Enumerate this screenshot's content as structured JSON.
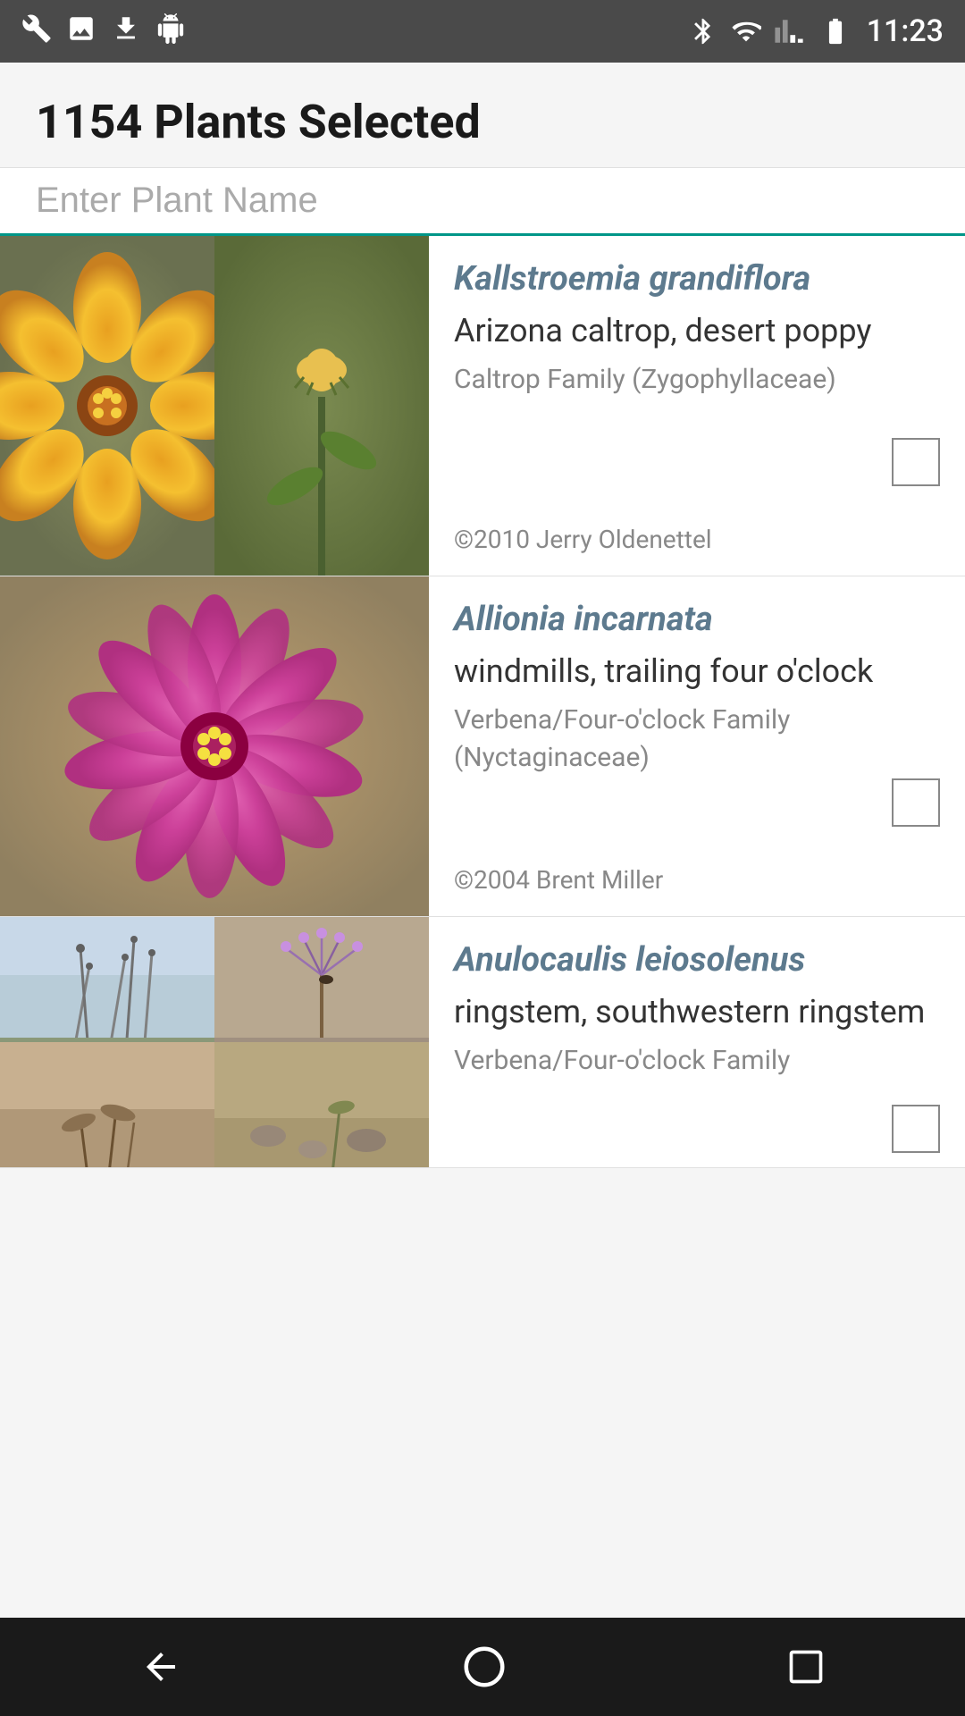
{
  "statusBar": {
    "time": "11:23",
    "icons": [
      "wrench",
      "image",
      "download",
      "android",
      "bluetooth",
      "wifi",
      "signal",
      "battery"
    ]
  },
  "header": {
    "title": "1154 Plants Selected"
  },
  "search": {
    "placeholder": "Enter Plant Name",
    "value": ""
  },
  "plants": [
    {
      "id": 1,
      "scientific": "Kallstroemia grandiflora",
      "common": "Arizona caltrop, desert poppy",
      "family": "Caltrop Family (Zygophyllaceae)",
      "copyright": "©2010 Jerry Oldenettel",
      "images": [
        "flower-yellow",
        "flower-yellow-bud"
      ],
      "imageLayout": "double"
    },
    {
      "id": 2,
      "scientific": "Allionia incarnata",
      "common": "windmills, trailing four o'clock",
      "family": "Verbena/Four-o'clock Family (Nyctaginaceae)",
      "copyright": "©2004 Brent Miller",
      "images": [
        "flower-pink"
      ],
      "imageLayout": "single"
    },
    {
      "id": 3,
      "scientific": "Anulocaulis leiosolenus",
      "common": "ringstem, southwestern ringstem",
      "family": "Verbena/Four-o'clock Family",
      "copyright": "",
      "images": [
        "plant-stem-gray",
        "plant-flower-small",
        "plant-ground",
        "plant-ground"
      ],
      "imageLayout": "quad"
    }
  ],
  "navBar": {
    "back": "◁",
    "home": "○",
    "recent": "□"
  }
}
